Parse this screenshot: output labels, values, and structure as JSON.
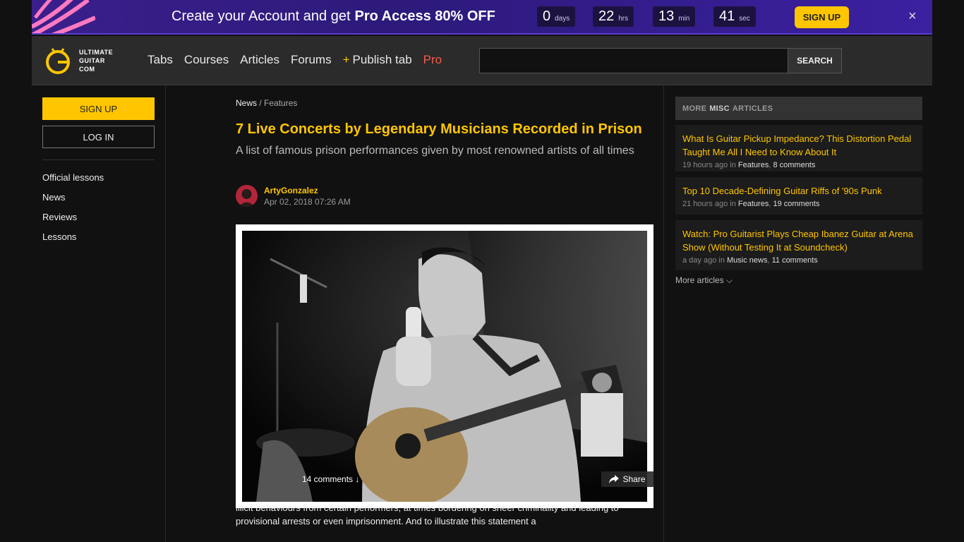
{
  "promo": {
    "text_start": "Create your Account and get",
    "text_bold": "Pro Access 80% OFF",
    "timer": [
      {
        "num": "0",
        "unit": "days"
      },
      {
        "num": "22",
        "unit": "hrs"
      },
      {
        "num": "13",
        "unit": "min"
      },
      {
        "num": "41",
        "unit": "sec"
      }
    ],
    "signup_label": "SIGN UP",
    "close_icon": "×"
  },
  "header": {
    "logo_lines": [
      "ULTIMATE",
      "GUITAR",
      "COM"
    ],
    "nav": {
      "tabs": "Tabs",
      "courses": "Courses",
      "articles": "Articles",
      "forums": "Forums",
      "publish_plus": "+",
      "publish": "Publish tab",
      "pro": "Pro"
    },
    "search_placeholder": "",
    "search_button": "SEARCH"
  },
  "left": {
    "signup": "SIGN UP",
    "login": "LOG IN",
    "menu": [
      "Official lessons",
      "News",
      "Reviews",
      "Lessons"
    ]
  },
  "article": {
    "breadcrumb_root": "News",
    "breadcrumb_sep": "/",
    "breadcrumb_sub": "Features",
    "title": "7 Live Concerts by Legendary Musicians Recorded in Prison",
    "subtitle": "A list of famous prison performances given by most renowned artists of all times",
    "author": "ArtyGonzalez",
    "date": "Apr 02, 2018 07:26 AM",
    "comments": "14 comments ↓",
    "share": "Share",
    "body": "illicit behaviours from certain performers, at times bordering on sheer criminality and leading to provisional arrests or even imprisonment. And to illustrate this statement a"
  },
  "right": {
    "header_more": "MORE",
    "header_misc": "MISC",
    "header_articles": "ARTICLES",
    "articles": [
      {
        "title": "What Is Guitar Pickup Impedance? This Distortion Pedal Taught Me All I Need to Know About It",
        "time": "19 hours ago in",
        "category": "Features",
        "comments": "8 comments"
      },
      {
        "title": "Top 10 Decade-Defining Guitar Riffs of '90s Punk",
        "time": "21 hours ago in",
        "category": "Features",
        "comments": "19 comments"
      },
      {
        "title": "Watch: Pro Guitarist Plays Cheap Ibanez Guitar at Arena Show (Without Testing It at Soundcheck)",
        "time": "a day ago in",
        "category": "Music news",
        "comments": "11 comments"
      }
    ],
    "more_link": "More articles ⌵"
  },
  "colors": {
    "accent": "#ffc600",
    "pro": "#f25b4a",
    "promo_bg": "#3a1f8c"
  }
}
